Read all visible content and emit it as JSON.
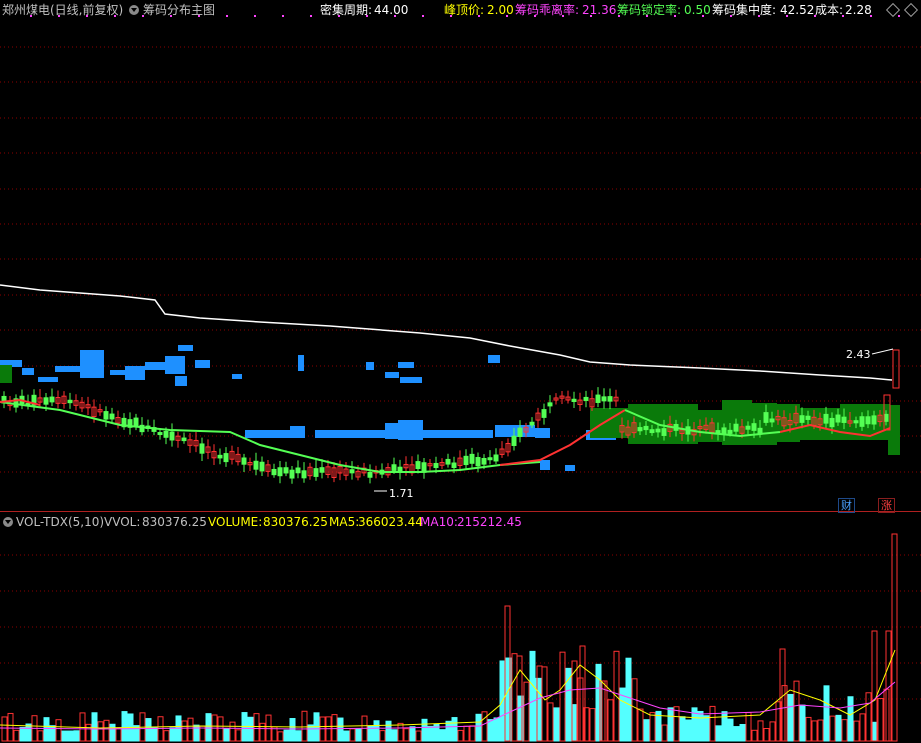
{
  "main_header": {
    "title": "郑州煤电(日线,前复权)",
    "indicator": "筹码分布主图",
    "cycle_label": "密集周期:",
    "cycle_value": "44.00",
    "peak_label": "峰顶价:",
    "peak_value": "2.00",
    "profit_label": "筹码乖离率:",
    "profit_value": "21.36",
    "lock_label": "筹码锁定率:",
    "lock_value": "0.50",
    "conc_label": "筹码集中度:",
    "conc_value": "42.52",
    "cost_label": "成本:",
    "cost_value": "2.28"
  },
  "price_annotations": {
    "high": "2.43",
    "low": "1.71"
  },
  "badges": {
    "finance": "财",
    "rise": "涨"
  },
  "vol_header": {
    "name": "VOL-TDX(5,10)",
    "vvol_label": "VVOL:",
    "vvol_value": "830376.25",
    "volume_label": "VOLUME:",
    "volume_value": "830376.25",
    "ma5_label": "MA5:",
    "ma5_value": "366023.44",
    "ma10_label": "MA10:",
    "ma10_value": "215212.45"
  },
  "colors": {
    "up": "#ff3232",
    "down": "#54ff54",
    "chip_blue": "#1e90ff",
    "chip_green": "#0a7a0a",
    "ma_white": "#ffffff",
    "ma5": "#ffff00",
    "ma10": "#ff44ff",
    "vol_down": "#54ffff",
    "grid": "#8b0000"
  },
  "icons": [
    "dropdown-circle-icon",
    "diamond-icon"
  ]
}
